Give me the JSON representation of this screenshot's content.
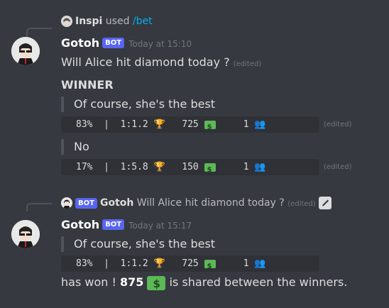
{
  "messages": [
    {
      "reply_context": {
        "user": "Inspi",
        "verb": "used",
        "command": "/bet"
      },
      "author": "Gotoh",
      "badge": "BOT",
      "timestamp": "Today at 15:10",
      "question": "Will Alice hit diamond today ?",
      "edited": "(edited)",
      "winner_label": "WINNER",
      "options": [
        {
          "text": "Of course, she's the best",
          "percent": "83%",
          "odds": "1:1.2",
          "amount": "725",
          "bettors": "1",
          "edited": "(edited)"
        },
        {
          "text": "No",
          "percent": "17%",
          "odds": "1:5.8",
          "amount": "150",
          "bettors": "1",
          "edited": "(edited)"
        }
      ]
    },
    {
      "reply_context": {
        "badge": "BOT",
        "user": "Gotoh",
        "text": "Will Alice hit diamond today ?",
        "edited": "(edited)"
      },
      "author": "Gotoh",
      "badge": "BOT",
      "timestamp": "Today at 15:17",
      "option": {
        "text": "Of course, she's the best",
        "percent": "83%",
        "odds": "1:1.2",
        "amount": "725",
        "bettors": "1"
      },
      "result_prefix": "has won !",
      "result_amount": "875",
      "result_suffix": "is shared between the winners."
    }
  ],
  "icons": [
    "trophy-icon",
    "money-icon",
    "people-icon",
    "edit-icon"
  ],
  "colors": {
    "background": "#36393f",
    "badge": "#5865f2",
    "command": "#00b0f4",
    "code_bg": "#2f3136"
  }
}
